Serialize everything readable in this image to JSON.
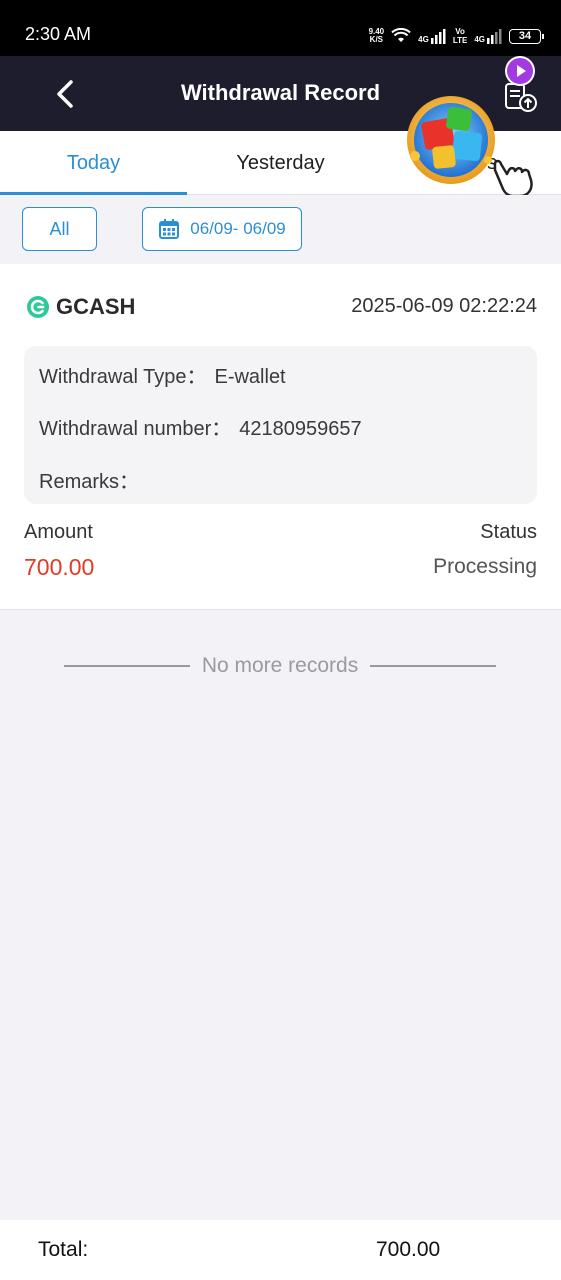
{
  "status_bar": {
    "time": "2:30 AM",
    "net_speed_value": "9.40",
    "net_speed_unit": "K/S",
    "net_4g_1": "4G",
    "volte_top": "Vo",
    "volte_bottom": "LTE",
    "net_4g_2": "4G",
    "battery": "34"
  },
  "header": {
    "title": "Withdrawal Record"
  },
  "tabs": [
    {
      "label": "Today",
      "active": true
    },
    {
      "label": "Yesterday",
      "active": false
    },
    {
      "label": "7 days",
      "active": false
    }
  ],
  "filters": {
    "all_label": "All",
    "date_range": "06/09- 06/09"
  },
  "record": {
    "method": "GCASH",
    "datetime": "2025-06-09 02:22:24",
    "type_label": "Withdrawal Type：",
    "type_value": "E-wallet",
    "number_label": "Withdrawal number：",
    "number_value": "42180959657",
    "remarks_label": "Remarks：",
    "amount_label": "Amount",
    "amount_value": "700.00",
    "status_label": "Status",
    "status_value": "Processing"
  },
  "no_more": "No more records",
  "footer": {
    "total_label": "Total:",
    "total_value": "700.00"
  },
  "colors": {
    "accent": "#2b8fd6",
    "header_bg": "#1e1d2e",
    "amount": "#e23b24",
    "gcash": "#2ec99a"
  },
  "icons": [
    "back-arrow-icon",
    "document-upload-icon",
    "play-icon",
    "calendar-icon",
    "gcash-logo-icon",
    "game-cube-icon",
    "pointing-hand-icon"
  ]
}
